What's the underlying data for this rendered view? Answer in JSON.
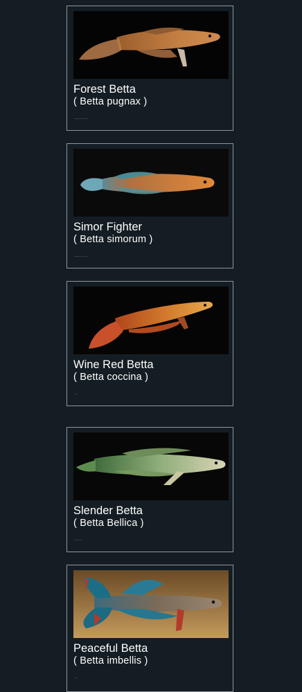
{
  "fish": [
    {
      "name": "Forest Betta",
      "scientific": "( Betta pugnax )",
      "icon": "forest-betta-photo"
    },
    {
      "name": "Simor Fighter",
      "scientific": "( Betta simorum )",
      "icon": "simor-fighter-photo"
    },
    {
      "name": "Wine Red Betta",
      "scientific": "( Betta coccina )",
      "icon": "wine-red-betta-photo"
    },
    {
      "name": "Slender Betta",
      "scientific": "( Betta Bellica )",
      "icon": "slender-betta-photo"
    },
    {
      "name": "Peaceful Betta",
      "scientific": "( Betta imbellis )",
      "icon": "peaceful-betta-photo"
    }
  ],
  "colors": {
    "background": "#141d23",
    "card_border": "#8f979c",
    "text": "#ffffff"
  }
}
